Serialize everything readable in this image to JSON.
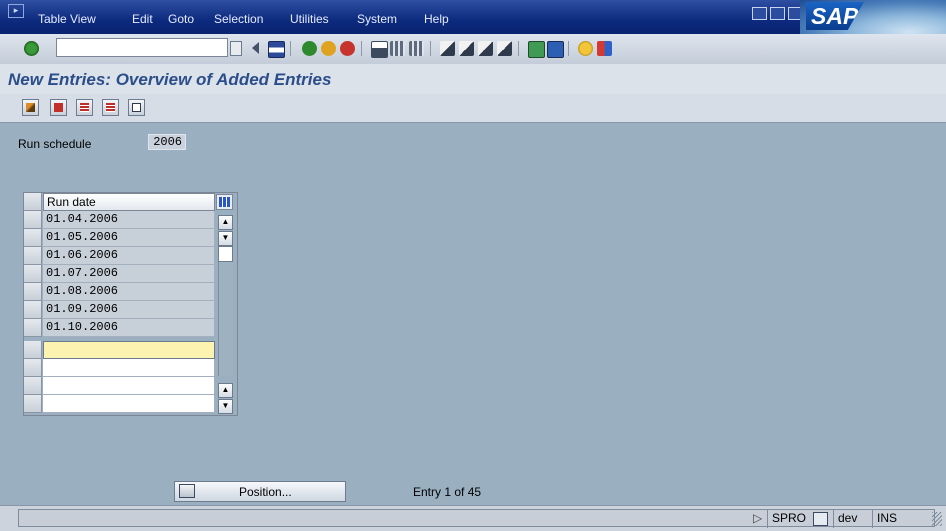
{
  "menubar": {
    "items": [
      "Table View",
      "Edit",
      "Goto",
      "Selection",
      "Utilities",
      "System",
      "Help"
    ],
    "logo_text": "SAP"
  },
  "toolbar": {
    "command_field_value": "",
    "icons": [
      "enter-icon",
      "save-icon",
      "back-icon",
      "exit-icon",
      "cancel-icon",
      "print-icon",
      "find-icon",
      "find-next-icon",
      "first-page-icon",
      "previous-page-icon",
      "next-page-icon",
      "last-page-icon",
      "create-session-icon",
      "shortcut-icon",
      "help-icon",
      "layout-icon"
    ]
  },
  "title": "New Entries: Overview of Added Entries",
  "app_toolbar": {
    "icons": [
      "change-display-icon",
      "select-all-icon",
      "select-block-icon",
      "deselect-all-icon",
      "deselect-icon"
    ]
  },
  "form": {
    "run_schedule_label": "Run schedule",
    "run_schedule_value": "2006"
  },
  "table": {
    "column_header": "Run date",
    "rows": [
      "01.04.2006",
      "01.05.2006",
      "01.06.2006",
      "01.07.2006",
      "01.08.2006",
      "01.09.2006",
      "01.10.2006",
      "",
      "",
      "",
      "",
      ""
    ]
  },
  "footer": {
    "position_button_label": "Position...",
    "entry_info": "Entry 1 of 45"
  },
  "status": {
    "transaction": "SPRO",
    "client": "dev",
    "mode": "INS"
  },
  "colors": {
    "menubar": "#0c2a7e",
    "background": "#9aafbf",
    "title": "#2b4d8a",
    "active_cell": "#fdf3b0"
  }
}
